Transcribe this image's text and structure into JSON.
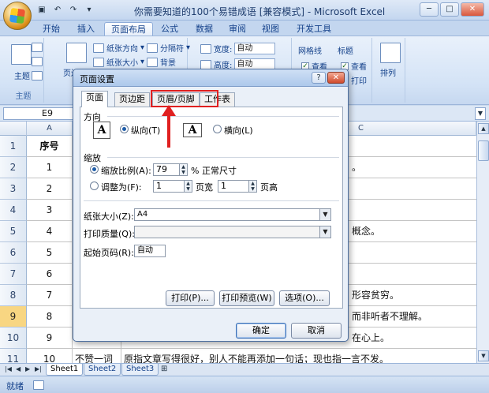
{
  "window": {
    "title": "你需要知道的100个易错成语 [兼容模式] - Microsoft Excel"
  },
  "ribbon_tabs": [
    "开始",
    "插入",
    "页面布局",
    "公式",
    "数据",
    "审阅",
    "视图",
    "开发工具"
  ],
  "ribbon": {
    "theme_group": {
      "label": "主题",
      "button": "主题"
    },
    "page_setup": {
      "margins": "页边距",
      "orientation": "纸张方向",
      "size": "纸张大小",
      "breaks": "分隔符",
      "background": "背景"
    },
    "scale": {
      "width_label": "宽度:",
      "width_value": "自动",
      "height_label": "高度:",
      "height_value": "自动"
    },
    "sheet_options": {
      "gridlines": "网格线",
      "headings": "标题",
      "view": "查看",
      "print": "打印"
    },
    "arrange": "排列"
  },
  "formula_bar": {
    "name_box": "E9"
  },
  "columns": [
    "A",
    "C"
  ],
  "rows": [
    {
      "num": "1",
      "a": "序号",
      "b": "",
      "c": ""
    },
    {
      "num": "2",
      "a": "1",
      "b": "",
      "c": "。"
    },
    {
      "num": "3",
      "a": "2",
      "b": "",
      "c": ""
    },
    {
      "num": "4",
      "a": "3",
      "b": "",
      "c": ""
    },
    {
      "num": "5",
      "a": "4",
      "b": "",
      "c": "概念。"
    },
    {
      "num": "6",
      "a": "5",
      "b": "",
      "c": ""
    },
    {
      "num": "7",
      "a": "6",
      "b": "",
      "c": ""
    },
    {
      "num": "8",
      "a": "7",
      "b": "",
      "c": "形容贫穷。"
    },
    {
      "num": "9",
      "a": "8",
      "b": "",
      "c": "而非听者不理解。"
    },
    {
      "num": "10",
      "a": "9",
      "b": "",
      "c": "在心上。"
    },
    {
      "num": "11",
      "a": "10",
      "b": "不赞一词",
      "c": "原指文章写得很好，别人不能再添加一句话；现也指一言不发。"
    }
  ],
  "sheet_tabs": [
    "Sheet1",
    "Sheet2",
    "Sheet3"
  ],
  "status": {
    "ready": "就绪"
  },
  "dialog": {
    "title": "页面设置",
    "help": "?",
    "tabs": [
      "页面",
      "页边距",
      "页眉/页脚",
      "工作表"
    ],
    "orientation_label": "方向",
    "portrait": "纵向(T)",
    "landscape": "横向(L)",
    "scaling_label": "缩放",
    "scale_option": "缩放比例(A):",
    "scale_value": "79",
    "scale_suffix": "% 正常尺寸",
    "fit_option": "调整为(F):",
    "fit_wide": "1",
    "fit_wide_suffix": "页宽",
    "fit_tall": "1",
    "fit_tall_suffix": "页高",
    "paper_size_label": "纸张大小(Z):",
    "paper_size_value": "A4",
    "print_quality_label": "打印质量(Q):",
    "print_quality_value": "",
    "first_page_label": "起始页码(R):",
    "first_page_value": "自动",
    "print_button": "打印(P)...",
    "preview_button": "打印预览(W)",
    "options_button": "选项(O)...",
    "ok_button": "确定",
    "cancel_button": "取消"
  },
  "colors": {
    "annotation": "#e02020",
    "accent": "#15428b"
  }
}
